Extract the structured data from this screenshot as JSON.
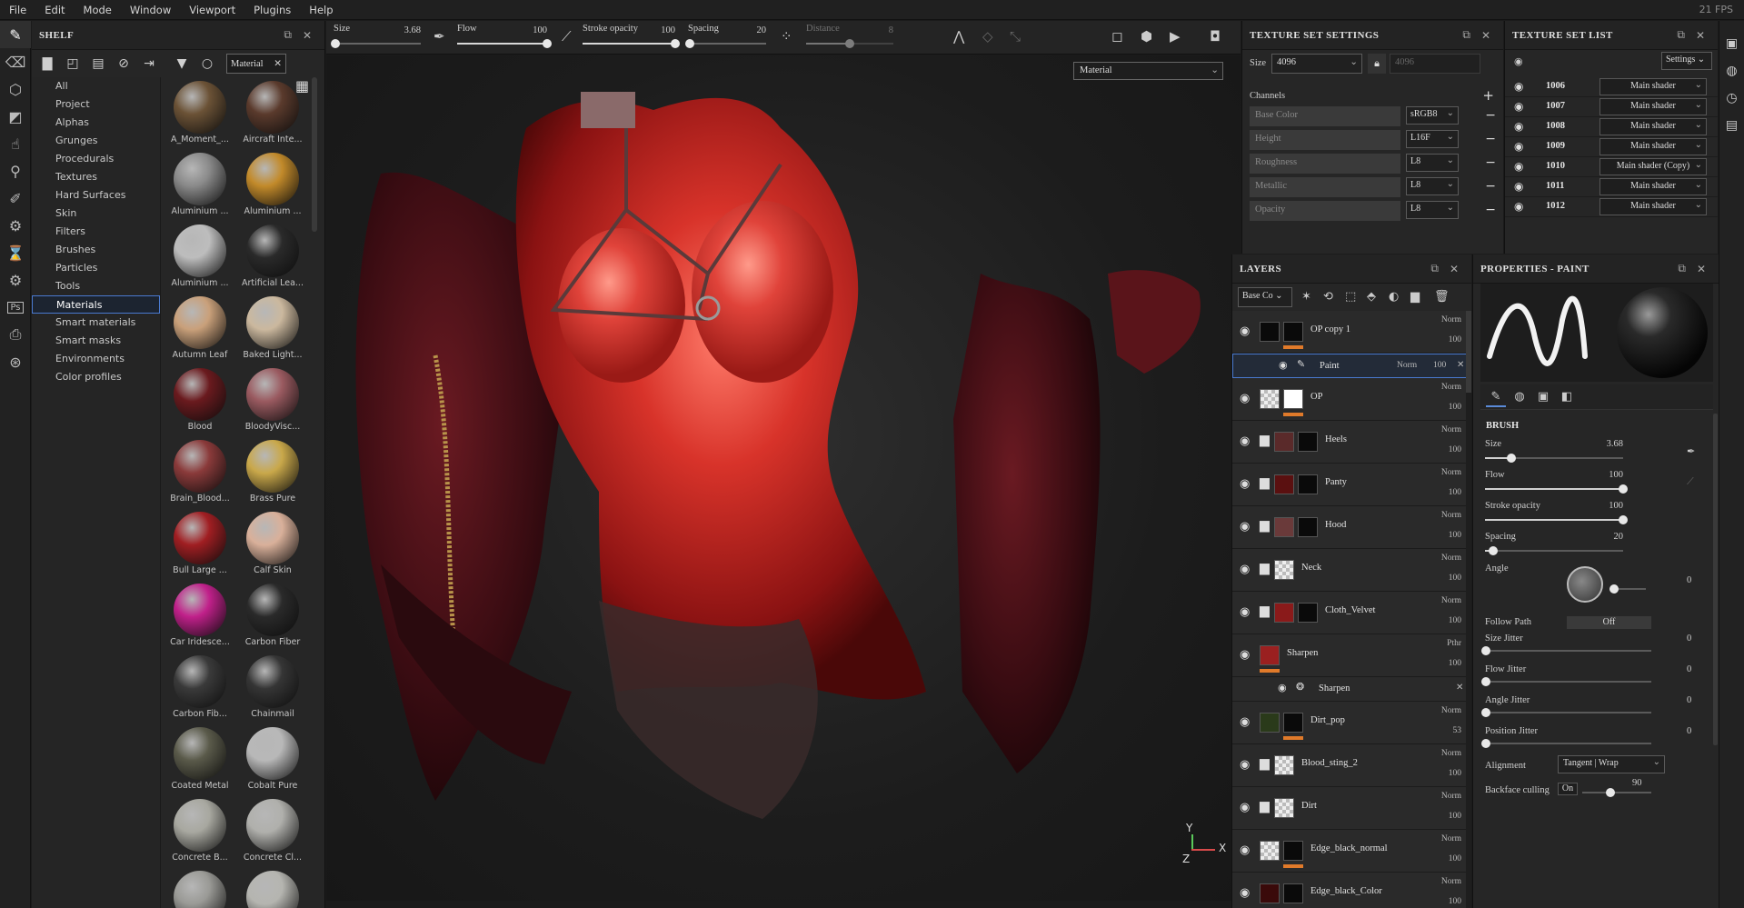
{
  "menu": [
    "File",
    "Edit",
    "Mode",
    "Window",
    "Viewport",
    "Plugins",
    "Help"
  ],
  "fps": "21 FPS",
  "shelf": {
    "title": "SHELF",
    "filter_label": "Material",
    "categories": [
      "All",
      "Project",
      "Alphas",
      "Grunges",
      "Procedurals",
      "Textures",
      "Hard Surfaces",
      "Skin",
      "Filters",
      "Brushes",
      "Particles",
      "Tools",
      "Materials",
      "Smart materials",
      "Smart masks",
      "Environments",
      "Color profiles"
    ],
    "selected_category": "Materials",
    "resources": [
      {
        "label": "A_Moment_...",
        "color": "#6b5236"
      },
      {
        "label": "Aircraft Inte...",
        "color": "#5a3a2c"
      },
      {
        "label": "Aluminium ...",
        "color": "#8a8a8a"
      },
      {
        "label": "Aluminium ...",
        "color": "#c28a2a"
      },
      {
        "label": "Aluminium ...",
        "color": "#bdbdbd"
      },
      {
        "label": "Artificial Lea...",
        "color": "#2a2a2a"
      },
      {
        "label": "Autumn Leaf",
        "color": "#c9a07a"
      },
      {
        "label": "Baked Light...",
        "color": "#cbb89e"
      },
      {
        "label": "Blood",
        "color": "#6a1a1e"
      },
      {
        "label": "BloodyVisc...",
        "color": "#9a5a60"
      },
      {
        "label": "Brain_Blood...",
        "color": "#8a3a3a"
      },
      {
        "label": "Brass Pure",
        "color": "#c9a84a"
      },
      {
        "label": "Bull Large ...",
        "color": "#a01e22"
      },
      {
        "label": "Calf Skin",
        "color": "#d9b09a"
      },
      {
        "label": "Car Iridesce...",
        "color": "#c0208a"
      },
      {
        "label": "Carbon Fiber",
        "color": "#2a2a2a"
      },
      {
        "label": "Carbon Fib...",
        "color": "#3a3a3a"
      },
      {
        "label": "Chainmail",
        "color": "#353535"
      },
      {
        "label": "Coated Metal",
        "color": "#5a5a4a"
      },
      {
        "label": "Cobalt Pure",
        "color": "#b8b8b8"
      },
      {
        "label": "Concrete B...",
        "color": "#a8a8a0"
      },
      {
        "label": "Concrete Cl...",
        "color": "#b0b0ac"
      },
      {
        "label": "",
        "color": "#9a9a96"
      },
      {
        "label": "",
        "color": "#b5b5b0"
      }
    ]
  },
  "tool_options": {
    "size_label": "Size",
    "size_value": "3.68",
    "size_frac": 0.02,
    "flow_label": "Flow",
    "flow_value": "100",
    "flow_frac": 1.0,
    "stroke_label": "Stroke opacity",
    "stroke_value": "100",
    "stroke_frac": 1.0,
    "spacing_label": "Spacing",
    "spacing_value": "20",
    "spacing_frac": 0.02,
    "distance_label": "Distance",
    "distance_value": "8",
    "distance_frac": 0.5
  },
  "viewport": {
    "channel": "Material",
    "axis_y": "Y",
    "axis_x": "X",
    "axis_z": "Z"
  },
  "texture_set_settings": {
    "title": "TEXTURE SET SETTINGS",
    "size_label": "Size",
    "size_value": "4096",
    "size_linked": "4096",
    "channels_label": "Channels",
    "channels": [
      {
        "name": "Base Color",
        "format": "sRGB8"
      },
      {
        "name": "Height",
        "format": "L16F"
      },
      {
        "name": "Roughness",
        "format": "L8"
      },
      {
        "name": "Metallic",
        "format": "L8"
      },
      {
        "name": "Opacity",
        "format": "L8"
      }
    ]
  },
  "texture_set_list": {
    "title": "TEXTURE SET LIST",
    "settings_label": "Settings",
    "items": [
      {
        "name": "1006",
        "shader": "Main shader"
      },
      {
        "name": "1007",
        "shader": "Main shader"
      },
      {
        "name": "1008",
        "shader": "Main shader"
      },
      {
        "name": "1009",
        "shader": "Main shader"
      },
      {
        "name": "1010",
        "shader": "Main shader (Copy)"
      },
      {
        "name": "1011",
        "shader": "Main shader"
      },
      {
        "name": "1012",
        "shader": "Main shader"
      }
    ]
  },
  "layers": {
    "title": "LAYERS",
    "channel": "Base Co",
    "items": [
      {
        "name": "OP copy 1",
        "blend": "Norm",
        "opacity": "100",
        "folder": false,
        "t1": "#0a0a0a",
        "t2": "#0a0a0a",
        "bar": "#e07a2a"
      },
      {
        "name": "OP",
        "blend": "Norm",
        "opacity": "100",
        "folder": false,
        "t1": "checker",
        "t2": "#ffffff",
        "bar": "#e07a2a"
      },
      {
        "name": "Heels",
        "blend": "Norm",
        "opacity": "100",
        "folder": true,
        "t1": "#5a2a2a",
        "t2": "#0a0a0a",
        "bar": ""
      },
      {
        "name": "Panty",
        "blend": "Norm",
        "opacity": "100",
        "folder": true,
        "t1": "#5a1010",
        "t2": "#0a0a0a",
        "bar": ""
      },
      {
        "name": "Hood",
        "blend": "Norm",
        "opacity": "100",
        "folder": true,
        "t1": "#6a3a3a",
        "t2": "#0a0a0a",
        "bar": ""
      },
      {
        "name": "Neck",
        "blend": "Norm",
        "opacity": "100",
        "folder": true,
        "t1": "checker",
        "t2": "",
        "bar": ""
      },
      {
        "name": "Cloth_Velvet",
        "blend": "Norm",
        "opacity": "100",
        "folder": true,
        "t1": "#8a1a1a",
        "t2": "#0a0a0a",
        "bar": ""
      },
      {
        "name": "Sharpen",
        "blend": "Pthr",
        "opacity": "100",
        "folder": false,
        "t1": "#9a2020",
        "t2": "",
        "bar": "#e07a2a"
      },
      {
        "name": "Dirt_pop",
        "blend": "Norm",
        "opacity": "53",
        "folder": false,
        "t1": "#2a3a1a",
        "t2": "#0a0a0a",
        "bar": "#e07a2a"
      },
      {
        "name": "Blood_sting_2",
        "blend": "Norm",
        "opacity": "100",
        "folder": true,
        "t1": "checker",
        "t2": "",
        "bar": ""
      },
      {
        "name": "Dirt",
        "blend": "Norm",
        "opacity": "100",
        "folder": true,
        "t1": "checker",
        "t2": "",
        "bar": ""
      },
      {
        "name": "Edge_black_normal",
        "blend": "Norm",
        "opacity": "100",
        "folder": false,
        "t1": "checker",
        "t2": "#0a0a0a",
        "bar": "#e07a2a"
      },
      {
        "name": "Edge_black_Color",
        "blend": "Norm",
        "opacity": "100",
        "folder": false,
        "t1": "#3a0a0a",
        "t2": "#0a0a0a",
        "bar": ""
      }
    ],
    "sub_paint": {
      "name": "Paint",
      "blend": "Norm",
      "opacity": "100"
    },
    "sub_sharpen": {
      "name": "Sharpen"
    }
  },
  "properties": {
    "title": "PROPERTIES - PAINT",
    "section": "BRUSH",
    "size_label": "Size",
    "size_value": "3.68",
    "size_frac": 0.19,
    "flow_label": "Flow",
    "flow_value": "100",
    "flow_frac": 1.0,
    "stroke_label": "Stroke opacity",
    "stroke_value": "100",
    "stroke_frac": 1.0,
    "spacing_label": "Spacing",
    "spacing_value": "20",
    "spacing_frac": 0.06,
    "angle_label": "Angle",
    "angle_value": "0",
    "follow_label": "Follow Path",
    "follow_value": "Off",
    "size_jitter_label": "Size Jitter",
    "size_jitter_value": "0",
    "flow_jitter_label": "Flow Jitter",
    "flow_jitter_value": "0",
    "angle_jitter_label": "Angle Jitter",
    "angle_jitter_value": "0",
    "pos_jitter_label": "Position Jitter",
    "pos_jitter_value": "0",
    "alignment_label": "Alignment",
    "alignment_value": "Tangent | Wrap",
    "backface_label": "Backface culling",
    "backface_value": "On",
    "backface_num": "90"
  }
}
